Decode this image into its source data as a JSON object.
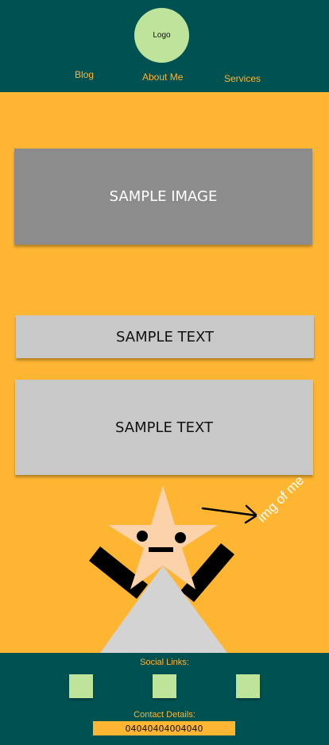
{
  "header": {
    "logo_text": "Logo",
    "nav": [
      {
        "label": "Blog"
      },
      {
        "label": "About Me"
      },
      {
        "label": "Services"
      }
    ]
  },
  "main": {
    "image_placeholder": "SAMPLE IMAGE",
    "text_block_1": "SAMPLE TEXT",
    "text_block_2": "SAMPLE TEXT",
    "figure_caption": "img of me"
  },
  "footer": {
    "social_label": "Social Links:",
    "contact_label": "Contact Details:",
    "phone": "04040404004040"
  },
  "colors": {
    "header_footer_bg": "#005151",
    "page_bg": "#FEB532",
    "logo_bg": "#BEE49B",
    "placeholder_dark": "#8C8C8C",
    "placeholder_light": "#C8C8C8",
    "skin": "#FCD2AA"
  },
  "icons": [
    "arrow-right-icon",
    "social-link-icon"
  ]
}
